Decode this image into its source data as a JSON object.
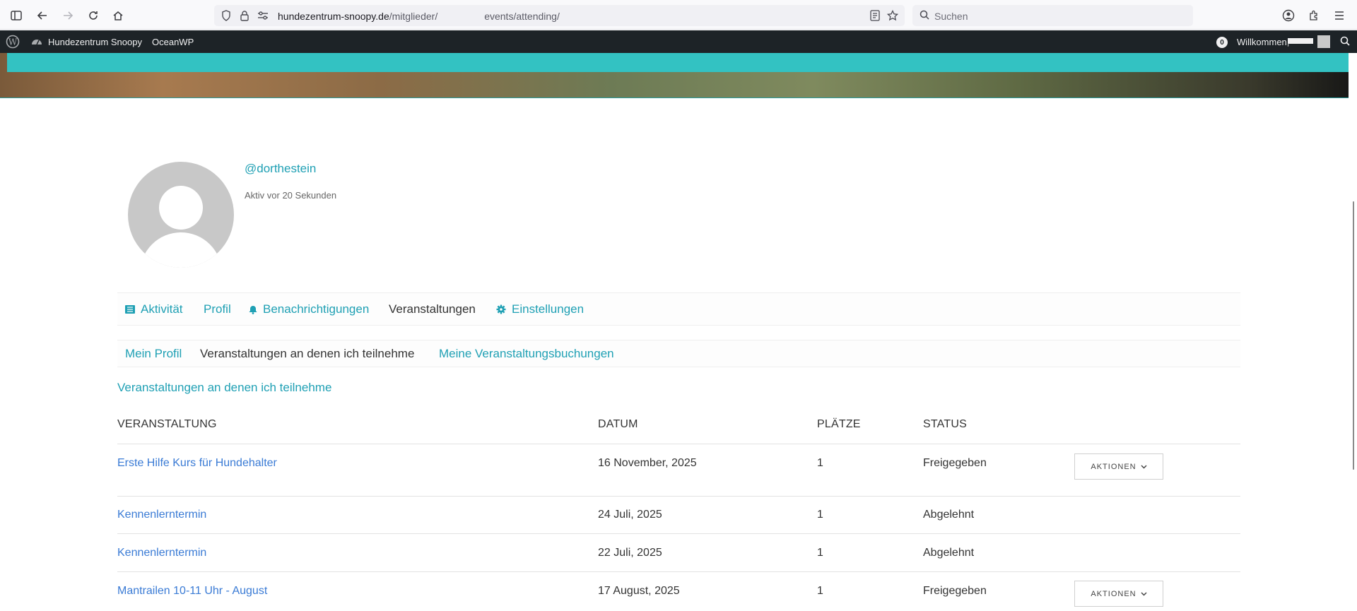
{
  "browser": {
    "url_host": "hundezentrum-snoopy.de",
    "url_path_start": "/mitglieder/",
    "url_path_end": "events/attending/",
    "search_placeholder": "Suchen"
  },
  "adminbar": {
    "site_name": "Hundezentrum Snoopy",
    "theme": "OceanWP",
    "notifications_count": "0",
    "welcome": "Willkommen,"
  },
  "profile": {
    "handle": "@dorthestein",
    "last_active": "Aktiv vor 20 Sekunden"
  },
  "main_nav": {
    "activity": "Aktivität",
    "profile": "Profil",
    "notifications": "Benachrichtigungen",
    "events": "Veranstaltungen",
    "settings": "Einstellungen"
  },
  "sub_nav": {
    "my_profile": "Mein Profil",
    "attending": "Veranstaltungen an denen ich teilnehme",
    "bookings": "Meine Veranstaltungsbuchungen"
  },
  "section_title": "Veranstaltungen an denen ich teilnehme",
  "table": {
    "headers": {
      "event": "Veranstaltung",
      "date": "Datum",
      "seats": "Plätze",
      "status": "Status"
    },
    "actions_label": "AKTIONEN",
    "rows": [
      {
        "event": "Erste Hilfe Kurs für Hundehalter",
        "date": "16 November, 2025",
        "seats": "1",
        "status": "Freigegeben"
      },
      {
        "event": "Kennenlerntermin",
        "date": "24 Juli, 2025",
        "seats": "1",
        "status": "Abgelehnt"
      },
      {
        "event": "Kennenlerntermin",
        "date": "22 Juli, 2025",
        "seats": "1",
        "status": "Abgelehnt"
      },
      {
        "event": "Mantrailen 10-11 Uhr - August",
        "date": "17 August, 2025",
        "seats": "1",
        "status": "Freigegeben"
      }
    ]
  },
  "colors": {
    "accent": "#1fa0b4",
    "link": "#3a7bd5",
    "adminbar": "#1d2327",
    "hero_strip": "#33c2c2"
  }
}
